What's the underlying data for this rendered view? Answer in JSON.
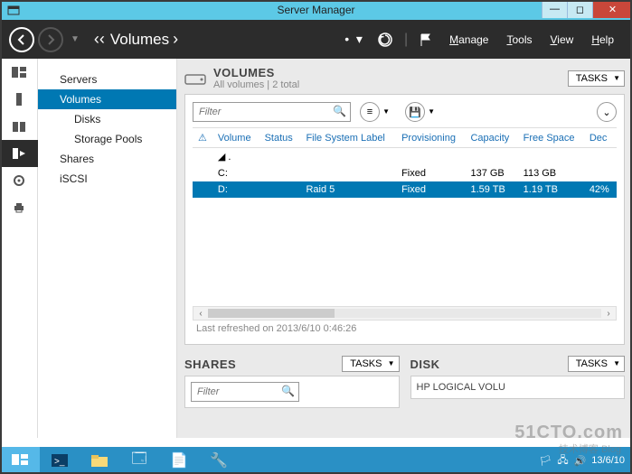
{
  "titlebar": {
    "title": "Server Manager"
  },
  "header": {
    "breadcrumb_prefix": "‹‹",
    "breadcrumb": "Volumes",
    "breadcrumb_caret": "›",
    "menu": {
      "manage": "Manage",
      "tools": "Tools",
      "view": "View",
      "help": "Help"
    }
  },
  "sidenav": {
    "items": [
      {
        "label": "Servers",
        "sub": false
      },
      {
        "label": "Volumes",
        "sub": false,
        "selected": true
      },
      {
        "label": "Disks",
        "sub": true
      },
      {
        "label": "Storage Pools",
        "sub": true
      },
      {
        "label": "Shares",
        "sub": false
      },
      {
        "label": "iSCSI",
        "sub": false
      }
    ]
  },
  "volumes_section": {
    "title": "VOLUMES",
    "subtitle": "All volumes | 2 total",
    "tasks_label": "TASKS",
    "filter_placeholder": "Filter",
    "columns": {
      "warn": "⚠",
      "volume": "Volume",
      "status": "Status",
      "fs_label": "File System Label",
      "provisioning": "Provisioning",
      "capacity": "Capacity",
      "free_space": "Free Space",
      "dedup": "Dec"
    },
    "group_toggle": "◢",
    "rows": [
      {
        "volume": "C:",
        "status": "",
        "fs_label": "",
        "provisioning": "Fixed",
        "capacity": "137 GB",
        "free_space": "113 GB",
        "dedup": "",
        "selected": false
      },
      {
        "volume": "D:",
        "status": "",
        "fs_label": "Raid 5",
        "provisioning": "Fixed",
        "capacity": "1.59 TB",
        "free_space": "1.19 TB",
        "dedup": "42%",
        "selected": true
      }
    ],
    "last_refreshed": "Last refreshed on 2013/6/10 0:46:26"
  },
  "shares_section": {
    "title": "SHARES",
    "tasks_label": "TASKS",
    "filter_placeholder": "Filter"
  },
  "disk_section": {
    "title": "DISK",
    "tasks_label": "TASKS",
    "disk_name": "HP LOGICAL VOLU"
  },
  "taskbar": {
    "tray": {
      "date": "13/6/10"
    }
  },
  "watermark": {
    "main": "51CTO.com",
    "sub": "技术博客 Blog"
  }
}
